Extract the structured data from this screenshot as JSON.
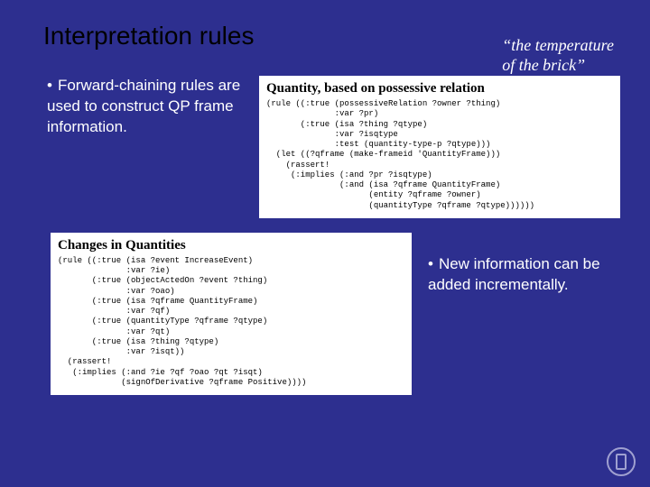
{
  "title": "Interpretation rules",
  "tagline_line1": "“the temperature",
  "tagline_line2": "of the brick”",
  "bullet_left": "Forward-chaining rules are used to construct QP frame information.",
  "box1": {
    "title": "Quantity, based on possessive relation",
    "code": "(rule ((:true (possessiveRelation ?owner ?thing)\n              :var ?pr)\n       (:true (isa ?thing ?qtype)\n              :var ?isqtype\n              :test (quantity-type-p ?qtype)))\n  (let ((?qframe (make-frameid 'QuantityFrame)))\n    (rassert!\n     (:implies (:and ?pr ?isqtype)\n               (:and (isa ?qframe QuantityFrame)\n                     (entity ?qframe ?owner)\n                     (quantityType ?qframe ?qtype))))))"
  },
  "box2": {
    "title": "Changes in Quantities",
    "code": "(rule ((:true (isa ?event IncreaseEvent)\n              :var ?ie)\n       (:true (objectActedOn ?event ?thing)\n              :var ?oao)\n       (:true (isa ?qframe QuantityFrame)\n              :var ?qf)\n       (:true (quantityType ?qframe ?qtype)\n              :var ?qt)\n       (:true (isa ?thing ?qtype)\n              :var ?isqt))\n  (rassert!\n   (:implies (:and ?ie ?qf ?oao ?qt ?isqt)\n             (signOfDerivative ?qframe Positive))))"
  },
  "bullet_right": "New information can be added incrementally."
}
